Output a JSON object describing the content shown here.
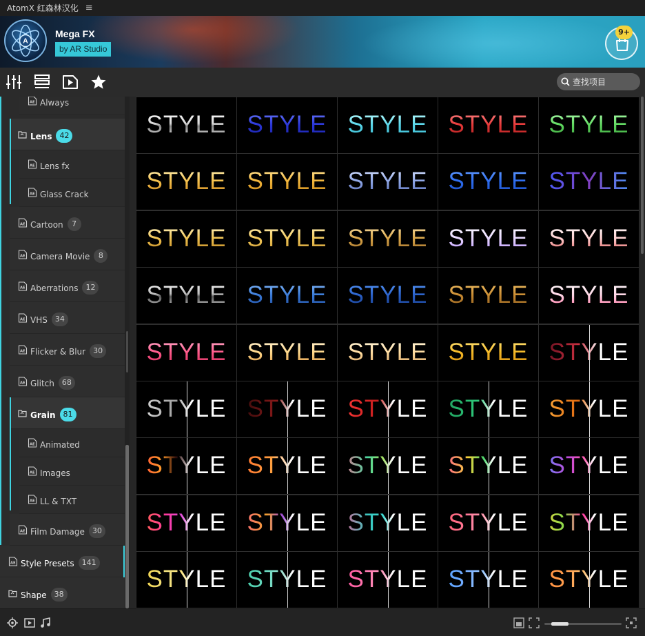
{
  "titlebar": {
    "title": "AtomX 红森林汉化",
    "menu_glyph": "≡"
  },
  "header": {
    "app_name": "Mega FX",
    "publisher": "by AR Studio",
    "cart_badge": "9+"
  },
  "toolbar": {
    "tools": [
      "sliders-icon",
      "list-icon",
      "video-play-icon",
      "star-icon"
    ],
    "search_placeholder": "查找项目"
  },
  "sidebar": {
    "items": [
      {
        "label": "Always",
        "count": "",
        "level": "sub",
        "selected": false
      },
      {
        "label": "Lens",
        "count": "42",
        "level": "group",
        "selected": true
      },
      {
        "label": "Lens fx",
        "count": "",
        "level": "sub",
        "selected": false
      },
      {
        "label": "Glass Crack",
        "count": "",
        "level": "sub",
        "selected": false
      },
      {
        "label": "Cartoon",
        "count": "7",
        "level": "item",
        "selected": false
      },
      {
        "label": "Camera Movie",
        "count": "8",
        "level": "item",
        "selected": false
      },
      {
        "label": "Aberrations",
        "count": "12",
        "level": "item",
        "selected": false
      },
      {
        "label": "VHS",
        "count": "34",
        "level": "item",
        "selected": false
      },
      {
        "label": "Flicker & Blur",
        "count": "30",
        "level": "item",
        "selected": false
      },
      {
        "label": "Glitch",
        "count": "68",
        "level": "item",
        "selected": false
      },
      {
        "label": "Grain",
        "count": "81",
        "level": "group",
        "selected": true
      },
      {
        "label": "Animated",
        "count": "",
        "level": "sub",
        "selected": false
      },
      {
        "label": "Images",
        "count": "",
        "level": "sub",
        "selected": false
      },
      {
        "label": "LL & TXT",
        "count": "",
        "level": "sub",
        "selected": false
      },
      {
        "label": "Film Damage",
        "count": "30",
        "level": "item",
        "selected": false
      }
    ],
    "top_items": [
      {
        "label": "Style Presets",
        "count": "141"
      },
      {
        "label": "Shape",
        "count": "38"
      }
    ]
  },
  "grid": {
    "label": "STYLE",
    "rows": [
      [
        {
          "style": "linear-gradient(180deg,#ffffff,#d9d9d9 45%,#8a8a8a 55%,#e0e0e0)",
          "split": false
        },
        {
          "style": "linear-gradient(180deg,#6c7cff,#2a36d8 50%,#1a22a0)",
          "split": false
        },
        {
          "style": "linear-gradient(180deg,#c8ffff,#58d6ea 50%,#39b7cc)",
          "split": false
        },
        {
          "style": "linear-gradient(180deg,#ff8a8a,#e63838 50%,#a81e1e)",
          "split": false
        },
        {
          "style": "linear-gradient(180deg,#b4ffb4,#5fd85f 50%,#3a9e3a)",
          "split": false
        }
      ],
      [
        {
          "style": "linear-gradient(180deg,#fff4c0,#f5c04a 50%,#c7801e)",
          "split": false
        },
        {
          "style": "linear-gradient(180deg,#ffe7a0,#f2b53a 50%,#c7861a)",
          "split": false
        },
        {
          "style": "linear-gradient(180deg,#dde6ff,#8ea6e6 50%,#5a6eb8)",
          "split": false
        },
        {
          "style": "linear-gradient(180deg,#6aa0ff,#2d6df0 50%,#1c4bbf)",
          "split": false
        },
        {
          "style": "linear-gradient(90deg,#4060ff,#8040c0,#40a0ff)",
          "split": false
        }
      ],
      [
        {
          "style": "linear-gradient(180deg,#fff6c8,#f0c250 50%,#b8801e)",
          "split": false
        },
        {
          "style": "linear-gradient(180deg,#fff0b8,#f2c85a 50%,#c89530)",
          "split": false
        },
        {
          "style": "linear-gradient(180deg,#fbe3a8,#d8a448 50%,#9e6e2a)",
          "split": false
        },
        {
          "style": "linear-gradient(180deg,#ffffff,#e8d8ff 50%,#b890ff)",
          "split": false
        },
        {
          "style": "linear-gradient(180deg,#ffffff,#ffd0d0 50%,#e05a5a)",
          "split": false
        }
      ],
      [
        {
          "style": "linear-gradient(180deg,#ffffff,#bcbcbc 45%,#5a5a5a 55%,#d0d0d0)",
          "split": false
        },
        {
          "style": "linear-gradient(180deg,#8ac0ff,#3a7ad8 50%,#1e4a98)",
          "split": false
        },
        {
          "style": "linear-gradient(180deg,#5a9cff,#2a60c8 50%,#183c88)",
          "split": false
        },
        {
          "style": "linear-gradient(180deg,#f7c66a,#c78a32 50%,#8a5a1e)",
          "split": false
        },
        {
          "style": "linear-gradient(180deg,#ffffff,#ffd6e6 50%,#ff6a9a)",
          "split": false
        }
      ],
      [
        {
          "style": "linear-gradient(180deg,#ffb0d0,#ff5a8a 50%,#d02a5a)",
          "split": false
        },
        {
          "style": "linear-gradient(180deg,#fff4d8,#ffd88a 50%,#d89040)",
          "split": false
        },
        {
          "style": "linear-gradient(180deg,#fff8e0,#ffdca0 50%,#d8a060)",
          "split": false
        },
        {
          "style": "linear-gradient(180deg,#ffe880,#f5b826 50%,#d08a10)",
          "split": false
        },
        {
          "style": "linear-gradient(90deg,#5a0a1a,#c83040 40%,#ffffff 60%,#ffffff)",
          "split": true
        }
      ],
      [
        {
          "style": "linear-gradient(90deg,#e0e0e0,#a0a0a0 40%,#ffffff 55%,#ffffff)",
          "split": true
        },
        {
          "style": "linear-gradient(90deg,#2a0808,#8a1a1a 40%,#ffffff 55%,#ffffff)",
          "split": true
        },
        {
          "style": "linear-gradient(90deg,#ff3a3a,#c81e1e 40%,#ffffff 55%,#ffffff)",
          "split": true
        },
        {
          "style": "linear-gradient(90deg,#1e9a5a,#2ec87a 40%,#ffffff 55%,#ffffff)",
          "split": true
        },
        {
          "style": "linear-gradient(90deg,#ffb040,#e06a10 40%,#ffffff 55%,#ffffff)",
          "split": true
        }
      ],
      [
        {
          "style": "linear-gradient(90deg,#ff3a3a,#ff9a2a 25%,#2a0a0a 40%,#ffffff 55%,#ffffff)",
          "split": true
        },
        {
          "style": "linear-gradient(90deg,#ff6a2a,#ffa040 35%,#ffffff 55%,#ffffff)",
          "split": true
        },
        {
          "style": "linear-gradient(90deg,#ff5a8a,#4ad8a0 30%,#a0e060 45%,#ffffff 55%,#ffffff)",
          "split": true
        },
        {
          "style": "linear-gradient(90deg,#ff3aa0,#f5d23a 30%,#4ad86a 45%,#ffffff 55%,#ffffff)",
          "split": true
        },
        {
          "style": "linear-gradient(90deg,#5a8aff,#c04ad8 30%,#ff5ab0 45%,#ffffff 55%,#ffffff)",
          "split": true
        }
      ],
      [
        {
          "style": "linear-gradient(90deg,#ff6a3a,#ff3aa0 30%,#e04ad8 45%,#ffffff 55%,#ffffff)",
          "split": true
        },
        {
          "style": "linear-gradient(90deg,#ff5a8a,#f0a030 30%,#a04ad8 45%,#ffffff 55%,#ffffff)",
          "split": true
        },
        {
          "style": "linear-gradient(90deg,#ff4a8a,#3ac8c0 30%,#3ad8d0 45%,#ffffff 55%,#ffffff)",
          "split": true
        },
        {
          "style": "linear-gradient(90deg,#ff5a6a,#ff7a9a 30%,#ff9ab0 45%,#ffffff 55%,#ffffff)",
          "split": true
        },
        {
          "style": "linear-gradient(90deg,#ffd23a,#8ad84a 25%,#ff3aa0 45%,#ffffff 55%,#ffffff)",
          "split": true
        }
      ],
      [
        {
          "style": "linear-gradient(90deg,#f5d23a,#f0e080 30%,#ffe880 45%,#ffffff 55%,#ffffff)",
          "split": true
        },
        {
          "style": "linear-gradient(90deg,#3ac8a0,#6ad8c0 30%,#9ae0d0 45%,#ffffff 55%,#ffffff)",
          "split": true
        },
        {
          "style": "linear-gradient(90deg,#ff4a9a,#ff7ab0 30%,#ff9ac0 45%,#ffffff 55%,#ffffff)",
          "split": true
        },
        {
          "style": "linear-gradient(90deg,#4a9aff,#7ab0ff 30%,#9ac8ff 45%,#ffffff 55%,#ffffff)",
          "split": true
        },
        {
          "style": "linear-gradient(90deg,#ff8a3a,#ffa050 30%,#ffc070 45%,#ffffff 55%,#ffffff)",
          "split": true
        }
      ]
    ]
  },
  "bottombar": {
    "left_icons": [
      "target-icon",
      "preview-icon",
      "music-icon"
    ],
    "right_icons": [
      "fit-icon",
      "fullscreen-icon",
      "expand-icon"
    ],
    "zoom_value": 0.22
  },
  "colors": {
    "accent": "#3fd3e0",
    "badge": "#f3d23c",
    "panel": "#2b2b2b"
  }
}
